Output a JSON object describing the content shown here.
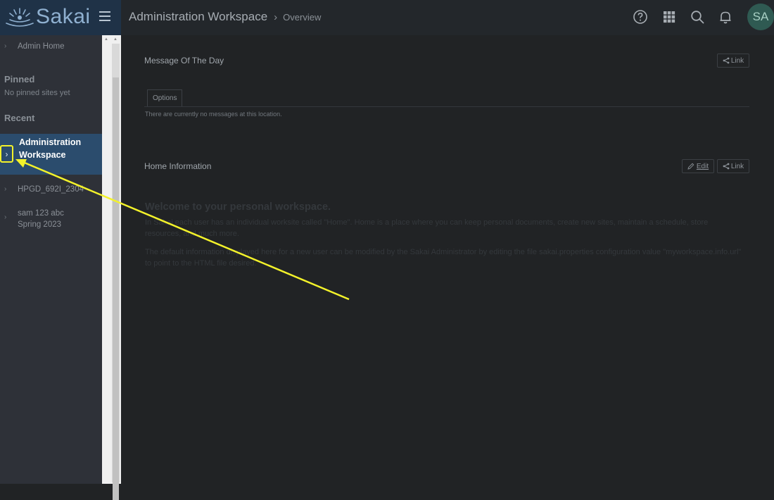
{
  "header": {
    "logo_text": "Sakai",
    "site_title": "Administration Workspace",
    "page_title": "Overview",
    "avatar_initials": "SA",
    "icons": [
      "help-icon",
      "apps-grid-icon",
      "search-icon",
      "bell-icon"
    ]
  },
  "sidebar": {
    "admin_home": "Admin Home",
    "pinned_heading": "Pinned",
    "pinned_empty": "No pinned sites yet",
    "recent_heading": "Recent",
    "active_site": "Administration Workspace",
    "sites": [
      {
        "label": "HPGD_692I_2304"
      },
      {
        "label": "sam 123 abc Spring 2023"
      }
    ]
  },
  "main": {
    "motd": {
      "title": "Message Of The Day",
      "link_label": "Link",
      "tab_label": "Options",
      "empty_text": "There are currently no messages at this location."
    },
    "home_info": {
      "title": "Home Information",
      "edit_label": "Edit",
      "link_label": "Link",
      "welcome_heading": "Welcome to your personal workspace.",
      "para1": "In Sakai each user has an individual worksite called \"Home\". Home is a place where you can keep personal documents, create new sites, maintain a schedule, store resources, and much more.",
      "para2": "The default information displayed here for a new user can be modified by the Sakai Administrator by editing the file sakai.properties configuration value \"myworkspace.info.url\" to point to the HTML file desired."
    }
  },
  "colors": {
    "header_bg": "#23272b",
    "logo_bg": "#1f3247",
    "sidebar_bg": "#2e3138",
    "active_bg": "#2b4c6d",
    "annotation": "#f3f22a",
    "main_bg": "#212325"
  }
}
